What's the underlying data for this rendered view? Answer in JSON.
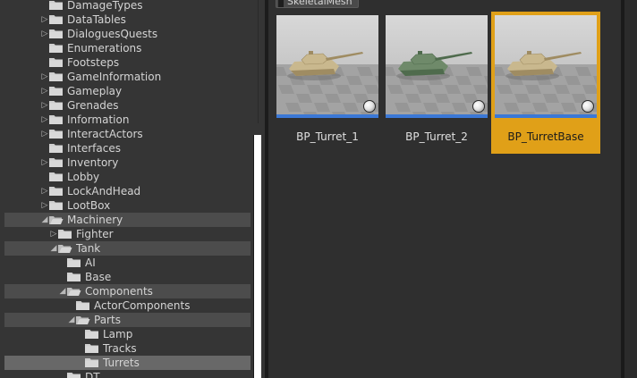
{
  "colors": {
    "tree_bg": "#353535",
    "asset_bg": "#2f2f2f",
    "selection_accent": "#e0a018",
    "thumbnail_bar": "#3b78d6",
    "folder_icon": "#cfcfcf"
  },
  "tree": {
    "items": [
      {
        "label": "DamageTypes",
        "depth": 0,
        "arrow": "",
        "state": ""
      },
      {
        "label": "DataTables",
        "depth": 0,
        "arrow": "collapsed",
        "state": ""
      },
      {
        "label": "DialoguesQuests",
        "depth": 0,
        "arrow": "collapsed",
        "state": ""
      },
      {
        "label": "Enumerations",
        "depth": 0,
        "arrow": "",
        "state": ""
      },
      {
        "label": "Footsteps",
        "depth": 0,
        "arrow": "",
        "state": ""
      },
      {
        "label": "GameInformation",
        "depth": 0,
        "arrow": "collapsed",
        "state": ""
      },
      {
        "label": "Gameplay",
        "depth": 0,
        "arrow": "collapsed",
        "state": ""
      },
      {
        "label": "Grenades",
        "depth": 0,
        "arrow": "collapsed",
        "state": ""
      },
      {
        "label": "Information",
        "depth": 0,
        "arrow": "collapsed",
        "state": ""
      },
      {
        "label": "InteractActors",
        "depth": 0,
        "arrow": "collapsed",
        "state": ""
      },
      {
        "label": "Interfaces",
        "depth": 0,
        "arrow": "",
        "state": ""
      },
      {
        "label": "Inventory",
        "depth": 0,
        "arrow": "collapsed",
        "state": ""
      },
      {
        "label": "Lobby",
        "depth": 0,
        "arrow": "",
        "state": ""
      },
      {
        "label": "LockAndHead",
        "depth": 0,
        "arrow": "collapsed",
        "state": ""
      },
      {
        "label": "LootBox",
        "depth": 0,
        "arrow": "collapsed",
        "state": ""
      },
      {
        "label": "Machinery",
        "depth": 0,
        "arrow": "expanded",
        "state": "hl"
      },
      {
        "label": "Fighter",
        "depth": 1,
        "arrow": "collapsed",
        "state": ""
      },
      {
        "label": "Tank",
        "depth": 1,
        "arrow": "expanded",
        "state": "hl"
      },
      {
        "label": "AI",
        "depth": 2,
        "arrow": "",
        "state": ""
      },
      {
        "label": "Base",
        "depth": 2,
        "arrow": "",
        "state": ""
      },
      {
        "label": "Components",
        "depth": 2,
        "arrow": "expanded",
        "state": "hl"
      },
      {
        "label": "ActorComponents",
        "depth": 3,
        "arrow": "",
        "state": ""
      },
      {
        "label": "Parts",
        "depth": 3,
        "arrow": "expanded",
        "state": "hl"
      },
      {
        "label": "Lamp",
        "depth": 4,
        "arrow": "",
        "state": ""
      },
      {
        "label": "Tracks",
        "depth": 4,
        "arrow": "",
        "state": ""
      },
      {
        "label": "Turrets",
        "depth": 4,
        "arrow": "",
        "state": "sel"
      },
      {
        "label": "DT",
        "depth": 2,
        "arrow": "",
        "state": ""
      }
    ]
  },
  "asset_view": {
    "filter_label": "SkeletalMesh",
    "assets": [
      {
        "label": "BP_Turret_1",
        "tank_color": "#c9b88e",
        "selected": false
      },
      {
        "label": "BP_Turret_2",
        "tank_color": "#6f8a6a",
        "selected": false
      },
      {
        "label": "BP_TurretBase",
        "tank_color": "#c9b88e",
        "selected": true
      }
    ]
  }
}
